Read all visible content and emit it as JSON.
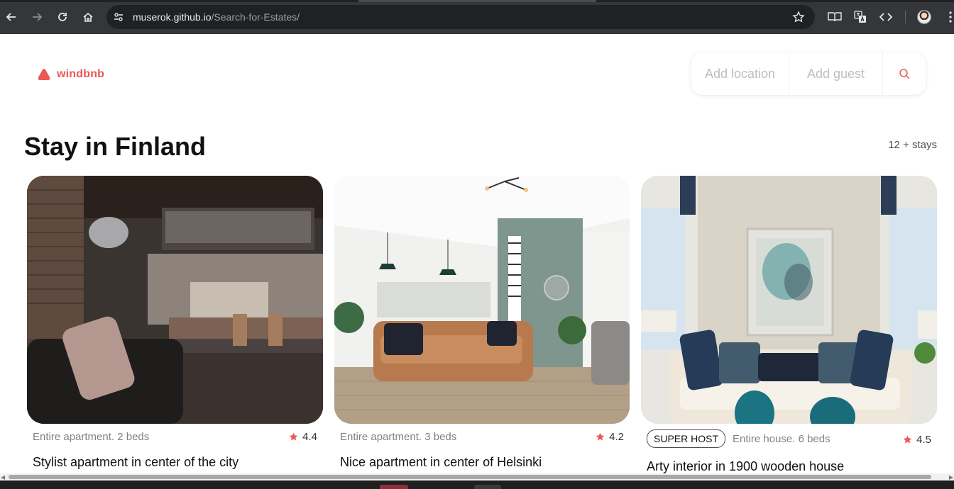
{
  "browser": {
    "url_host": "muserok.github.io",
    "url_path": "/Search-for-Estates/"
  },
  "app": {
    "brand": "windbnb",
    "brand_color": "#eb5757",
    "search": {
      "location_placeholder": "Add location",
      "guest_placeholder": "Add guest"
    },
    "heading": "Stay in Finland",
    "stays_count": "12 + stays"
  },
  "cards": [
    {
      "meta": "Entire apartment. 2 beds",
      "rating": "4.4",
      "title": "Stylist apartment in center of the city",
      "super_host": ""
    },
    {
      "meta": "Entire apartment. 3 beds",
      "rating": "4.2",
      "title": "Nice apartment in center of Helsinki",
      "super_host": ""
    },
    {
      "meta": "Entire house. 6 beds",
      "rating": "4.5",
      "title": "Arty interior in 1900 wooden house",
      "super_host": "SUPER HOST"
    }
  ]
}
